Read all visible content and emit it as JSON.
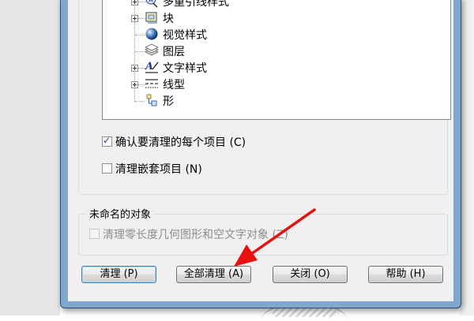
{
  "tree": {
    "items": [
      {
        "label": "多重引线样式",
        "icon": "multileader-style-icon",
        "expandable": true
      },
      {
        "label": "块",
        "icon": "block-icon",
        "expandable": true
      },
      {
        "label": "视觉样式",
        "icon": "visual-style-sphere-icon",
        "expandable": false
      },
      {
        "label": "图层",
        "icon": "layers-icon",
        "expandable": false
      },
      {
        "label": "文字样式",
        "icon": "text-style-icon",
        "expandable": true
      },
      {
        "label": "线型",
        "icon": "linetype-icon",
        "expandable": true
      },
      {
        "label": "形",
        "icon": "shape-icon",
        "expandable": false
      }
    ]
  },
  "options": {
    "confirm_label": "确认要清理的每个项目 (C)",
    "confirm_checked": true,
    "nested_label": "清理嵌套项目 (N)",
    "nested_checked": false
  },
  "unnamed": {
    "title": "未命名的对象",
    "zero_label": "清理零长度几何图形和空文字对象 (Z)",
    "zero_checked": false,
    "zero_disabled": true
  },
  "buttons": {
    "purge": "清理 (P)",
    "purge_all": "全部清理 (A)",
    "close": "关闭 (O)",
    "help": "帮助 (H)"
  },
  "colors": {
    "window_frame": "#7fa7d0",
    "annotation_arrow": "#e8100e"
  }
}
